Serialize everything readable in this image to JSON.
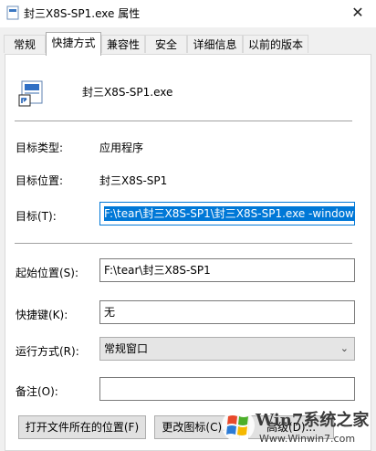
{
  "window": {
    "title": "封三X8S-SP1.exe 属性",
    "close": "✕"
  },
  "tabs": [
    {
      "label": "常规",
      "active": false
    },
    {
      "label": "快捷方式",
      "active": true
    },
    {
      "label": "兼容性",
      "active": false
    },
    {
      "label": "安全",
      "active": false
    },
    {
      "label": "详细信息",
      "active": false
    },
    {
      "label": "以前的版本",
      "active": false
    }
  ],
  "shortcut": {
    "file_name": "封三X8S-SP1.exe",
    "target_type_label": "目标类型:",
    "target_type_value": "应用程序",
    "target_location_label": "目标位置:",
    "target_location_value": "封三X8S-SP1",
    "target_label": "目标(T):",
    "target_value": "F:\\tear\\封三X8S-SP1\\封三X8S-SP1.exe -window",
    "start_in_label": "起始位置(S):",
    "start_in_value": "F:\\tear\\封三X8S-SP1",
    "hotkey_label": "快捷键(K):",
    "hotkey_value": "无",
    "run_label": "运行方式(R):",
    "run_value": "常规窗口",
    "comment_label": "备注(O):",
    "comment_value": ""
  },
  "buttons": {
    "open_location": "打开文件所在的位置(F)",
    "change_icon": "更改图标(C)...",
    "advanced": "高级(D)..."
  },
  "watermark": {
    "brand": "Win7系统之家",
    "url": "Www.Winwin7.com"
  },
  "colors": {
    "accent": "#0078d7",
    "panel": "#ffffff",
    "background": "#f0f0f0"
  }
}
